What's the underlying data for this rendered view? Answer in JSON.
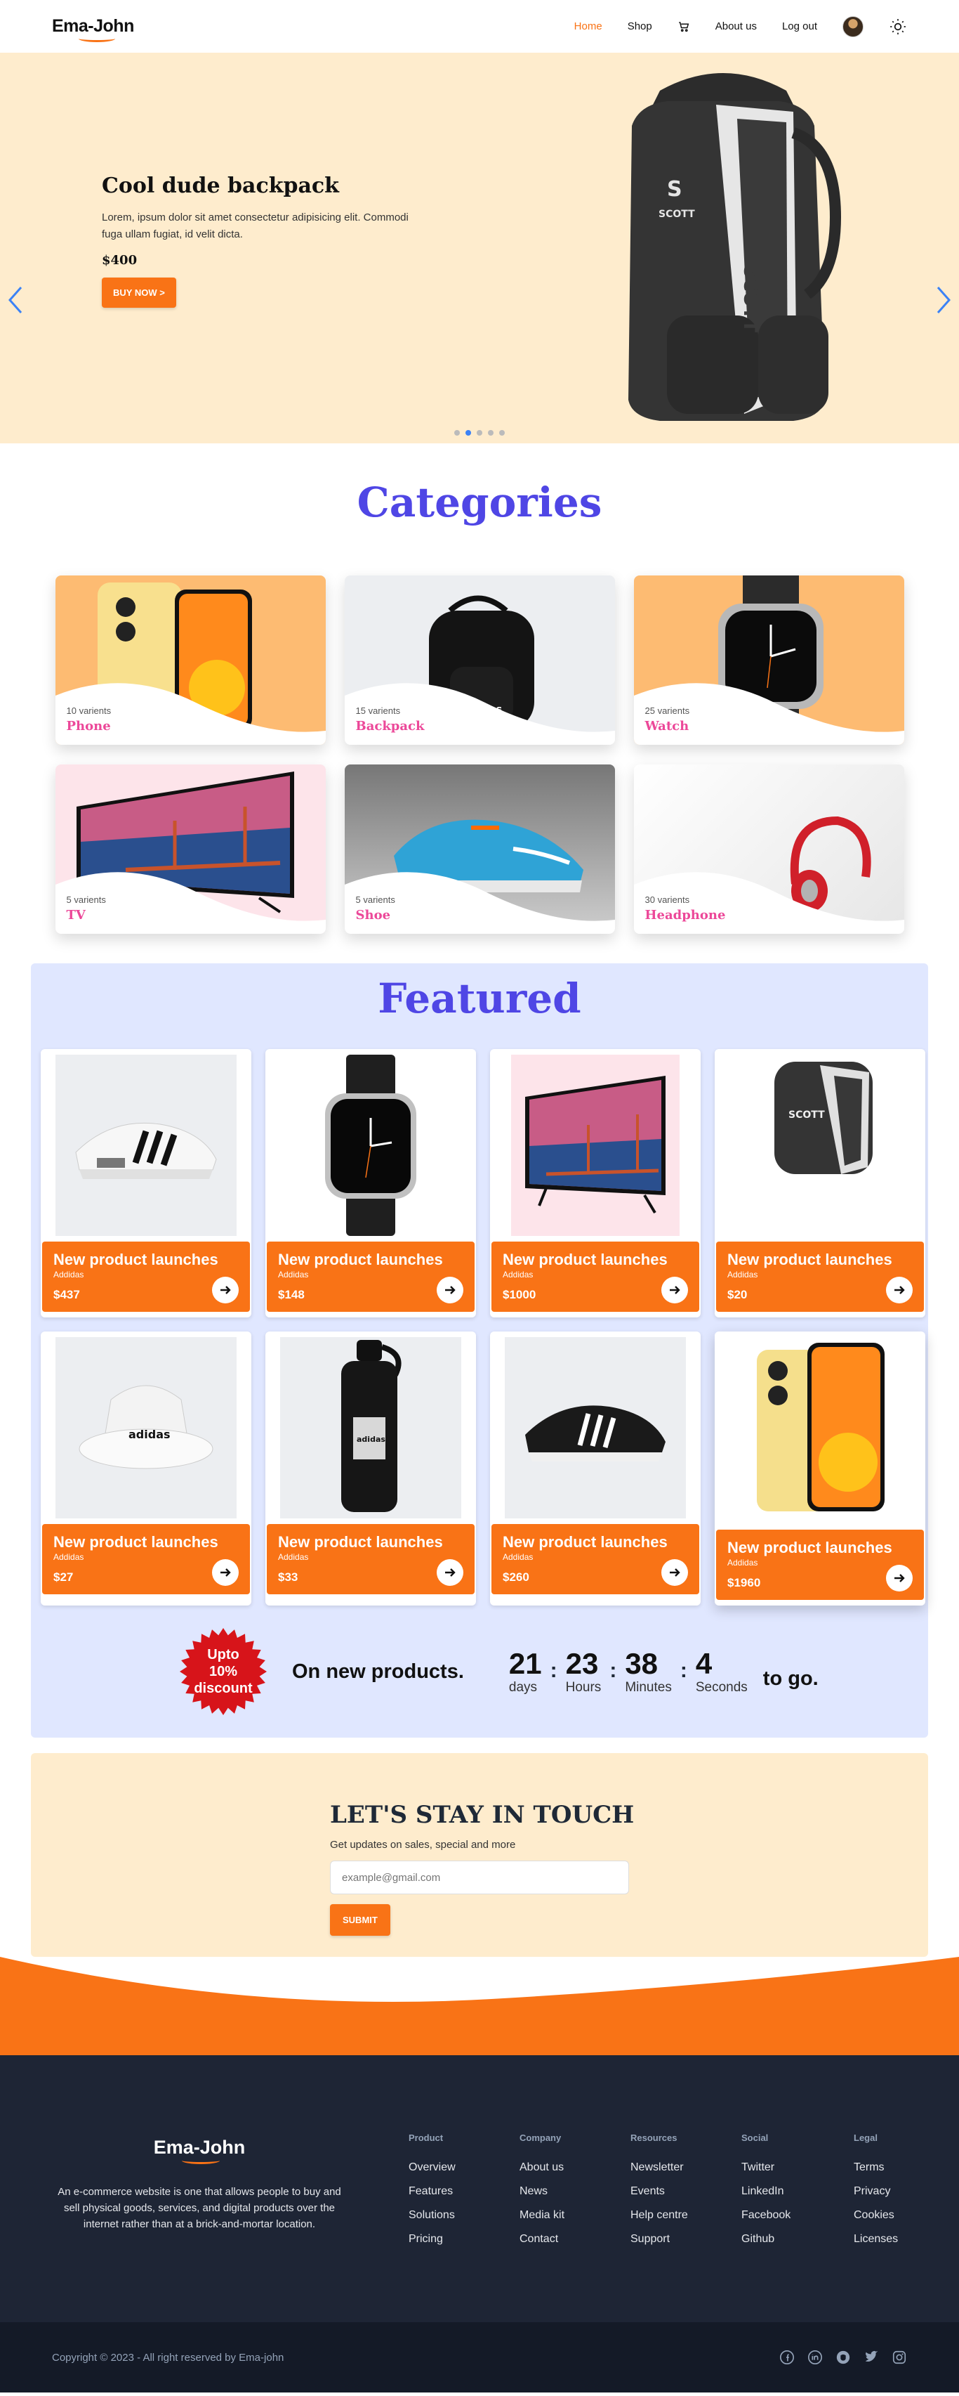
{
  "nav": {
    "logo": "Ema-John",
    "links": [
      {
        "label": "Home",
        "active": true
      },
      {
        "label": "Shop"
      },
      {
        "label": "About us"
      },
      {
        "label": "Log out"
      }
    ],
    "icons": [
      "cart-icon",
      "avatar",
      "sun-icon"
    ]
  },
  "hero": {
    "title": "Cool dude backpack",
    "description": "Lorem, ipsum dolor sit amet consectetur adipisicing elit. Commodi fuga ullam fugiat, id velit dicta.",
    "price": "$400",
    "button": "BUY NOW >",
    "slide_count": 5,
    "active_slide": 2
  },
  "categories": {
    "title": "Categories",
    "items": [
      {
        "variants": "10 varients",
        "name": "Phone"
      },
      {
        "variants": "15 varients",
        "name": "Backpack"
      },
      {
        "variants": "25 varients",
        "name": "Watch"
      },
      {
        "variants": "5 varients",
        "name": "TV"
      },
      {
        "variants": "5 varients",
        "name": "Shoe"
      },
      {
        "variants": "30 varients",
        "name": "Headphone"
      }
    ]
  },
  "featured": {
    "title": "Featured",
    "products": [
      {
        "title": "New product launches",
        "brand": "Addidas",
        "price": "$437"
      },
      {
        "title": "New product launches",
        "brand": "Addidas",
        "price": "$148"
      },
      {
        "title": "New product launches",
        "brand": "Addidas",
        "price": "$1000"
      },
      {
        "title": "New product launches",
        "brand": "Addidas",
        "price": "$20"
      },
      {
        "title": "New product launches",
        "brand": "Addidas",
        "price": "$27"
      },
      {
        "title": "New product launches",
        "brand": "Addidas",
        "price": "$33"
      },
      {
        "title": "New product launches",
        "brand": "Addidas",
        "price": "$260"
      },
      {
        "title": "New product launches",
        "brand": "Addidas",
        "price": "$1960"
      }
    ],
    "badge": {
      "line1": "Upto",
      "line2": "10%",
      "line3": "discount"
    },
    "promo": "On new products.",
    "countdown": {
      "days": "21",
      "days_label": "days",
      "hours": "23",
      "hours_label": "Hours",
      "minutes": "38",
      "minutes_label": "Minutes",
      "seconds": "4",
      "seconds_label": "Seconds"
    },
    "togo": "to go."
  },
  "touch": {
    "title": "LET'S STAY IN TOUCH",
    "subtitle": "Get updates on sales, special and more",
    "placeholder": "example@gmail.com",
    "button": "SUBMIT"
  },
  "footer": {
    "logo": "Ema-John",
    "description": "An e-commerce website is one that allows people to buy and sell physical goods, services, and digital products over the internet rather than at a brick-and-mortar location.",
    "columns": [
      {
        "head": "Product",
        "items": [
          "Overview",
          "Features",
          "Solutions",
          "Pricing"
        ]
      },
      {
        "head": "Company",
        "items": [
          "About us",
          "News",
          "Media kit",
          "Contact"
        ]
      },
      {
        "head": "Resources",
        "items": [
          "Newsletter",
          "Events",
          "Help centre",
          "Support"
        ]
      },
      {
        "head": "Social",
        "items": [
          "Twitter",
          "LinkedIn",
          "Facebook",
          "Github"
        ]
      },
      {
        "head": "Legal",
        "items": [
          "Terms",
          "Privacy",
          "Cookies",
          "Licenses"
        ]
      }
    ],
    "copyright": "Copyright © 2023 - All right reserved by Ema-john",
    "social_icons": [
      "facebook-icon",
      "linkedin-icon",
      "github-icon",
      "twitter-icon",
      "instagram-icon"
    ]
  },
  "colors": {
    "accent": "#f97316",
    "primary": "#4f46e5",
    "hero_bg": "#feeccd",
    "featured_bg": "#e0e7ff",
    "footer_bg": "#1e2535",
    "category_name": "#ec4899"
  }
}
